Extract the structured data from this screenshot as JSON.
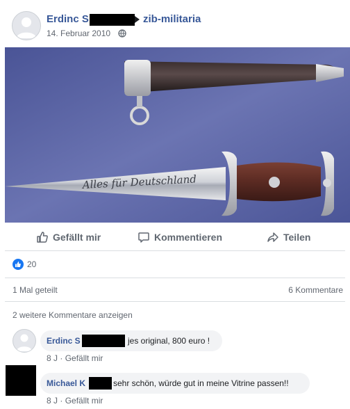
{
  "post": {
    "author_first": "Erdinc S",
    "group": "zib-militaria",
    "date": "14. Februar 2010",
    "reactions_count": "20",
    "shares": "1 Mal geteilt",
    "comments_count": "6 Kommentare"
  },
  "actions": {
    "like": "Gefällt mir",
    "comment": "Kommentieren",
    "share": "Teilen"
  },
  "more_comments": "2 weitere Kommentare anzeigen",
  "comments": [
    {
      "author": "Erdinc S",
      "text": "jes original, 800 euro !",
      "time": "8 J",
      "like": "Gefällt mir"
    },
    {
      "author": "Michael K",
      "text": "sehr schön, würde gut in meine Vitrine passen!!",
      "time": "8 J",
      "like": "Gefällt mir"
    }
  ],
  "image": {
    "blade_engraving": "Alles für Deutschland"
  },
  "colors": {
    "link": "#385898",
    "like_blue": "#1877f2",
    "photo_background": "#5e68a6"
  },
  "icons": [
    "globe-icon",
    "thumbs-up-icon",
    "comment-icon",
    "share-icon",
    "like-reaction-icon"
  ]
}
